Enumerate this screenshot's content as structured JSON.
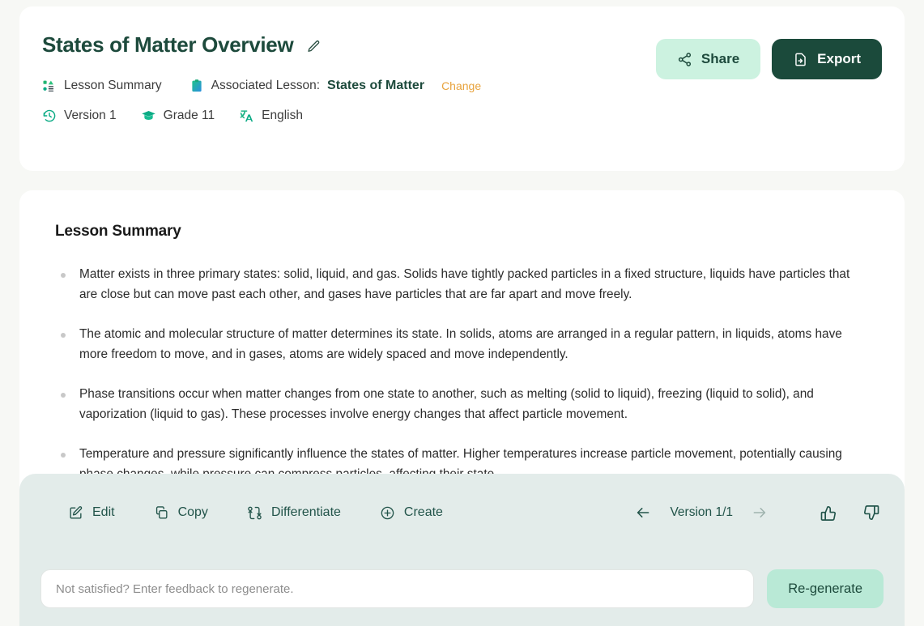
{
  "header": {
    "title": "States of Matter Overview",
    "edit_icon": "pencil-icon",
    "share_label": "Share",
    "export_label": "Export",
    "meta": {
      "type_label": "Lesson Summary",
      "associated_prefix": "Associated Lesson:",
      "associated_lesson": "States of Matter",
      "change_label": "Change",
      "version_label": "Version 1",
      "grade_label": "Grade 11",
      "language_label": "English"
    }
  },
  "content": {
    "section_title": "Lesson Summary",
    "bullets": [
      "Matter exists in three primary states: solid, liquid, and gas. Solids have tightly packed particles in a fixed structure, liquids have particles that are close but can move past each other, and gases have particles that are far apart and move freely.",
      "The atomic and molecular structure of matter determines its state. In solids, atoms are arranged in a regular pattern, in liquids, atoms have more freedom to move, and in gases, atoms are widely spaced and move independently.",
      "Phase transitions occur when matter changes from one state to another, such as melting (solid to liquid), freezing (liquid to solid), and vaporization (liquid to gas). These processes involve energy changes that affect particle movement.",
      "Temperature and pressure significantly influence the states of matter. Higher temperatures increase particle movement, potentially causing phase changes, while pressure can compress particles, affecting their state."
    ]
  },
  "toolbar": {
    "edit_label": "Edit",
    "copy_label": "Copy",
    "differentiate_label": "Differentiate",
    "create_label": "Create",
    "version_nav_label": "Version 1/1",
    "prev_icon": "arrow-left-icon",
    "next_icon": "arrow-right-icon",
    "thumbs_up_icon": "thumbs-up-icon",
    "thumbs_down_icon": "thumbs-down-icon"
  },
  "feedback": {
    "placeholder": "Not satisfied? Enter feedback to regenerate.",
    "value": "",
    "regenerate_label": "Re-generate"
  },
  "colors": {
    "page_bg": "#f7f8f5",
    "card_bg": "#ffffff",
    "brand_dark_green": "#1b4a3b",
    "mint": "#ccf2e0",
    "regenerate_mint": "#b9e9d6",
    "toolbar_bg": "#e3ecea",
    "accent_orange": "#e8a33d",
    "teal_icon": "#0cab85"
  }
}
